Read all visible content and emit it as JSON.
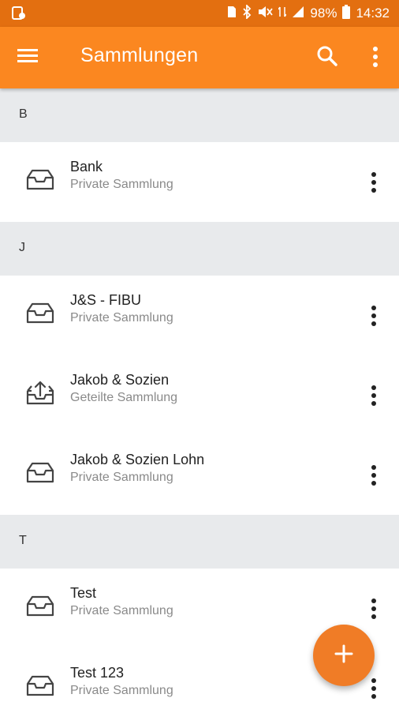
{
  "status_bar": {
    "battery_text": "98%",
    "time": "14:32"
  },
  "app_bar": {
    "title": "Sammlungen"
  },
  "sections": [
    {
      "letter": "B",
      "items": [
        {
          "title": "Bank",
          "subtitle": "Private Sammlung",
          "icon": "inbox-tray-icon"
        }
      ]
    },
    {
      "letter": "J",
      "items": [
        {
          "title": "J&S - FIBU",
          "subtitle": "Private Sammlung",
          "icon": "inbox-tray-icon"
        },
        {
          "title": "Jakob & Sozien",
          "subtitle": "Geteilte Sammlung",
          "icon": "shared-tray-icon"
        },
        {
          "title": "Jakob & Sozien Lohn",
          "subtitle": "Private Sammlung",
          "icon": "inbox-tray-icon"
        }
      ]
    },
    {
      "letter": "T",
      "items": [
        {
          "title": "Test",
          "subtitle": "Private Sammlung",
          "icon": "inbox-tray-icon"
        },
        {
          "title": "Test 123",
          "subtitle": "Private Sammlung",
          "icon": "inbox-tray-icon"
        }
      ]
    }
  ],
  "colors": {
    "status_bar": "#e36f10",
    "app_bar": "#fb8720",
    "fab": "#f07c26",
    "section_header": "#e8eaec"
  }
}
